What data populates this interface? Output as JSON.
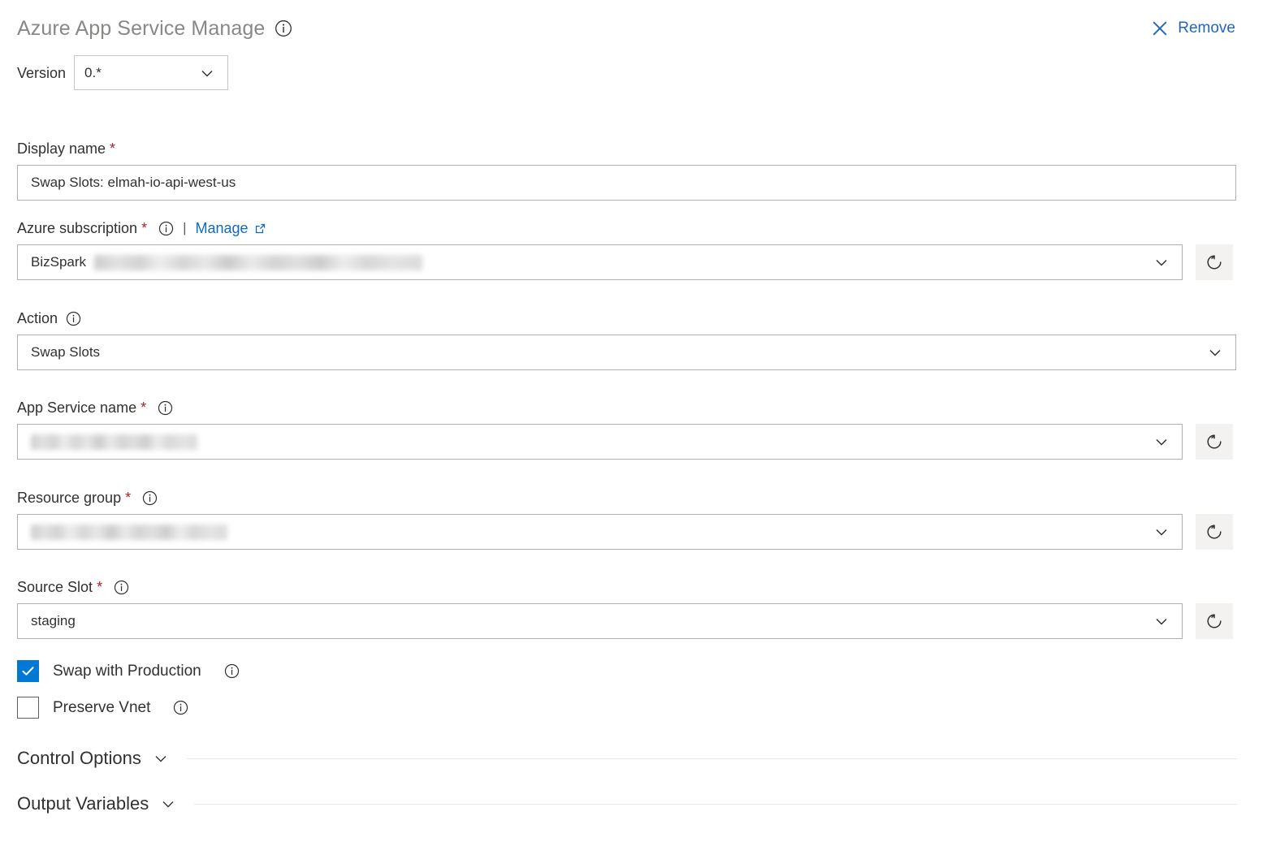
{
  "header": {
    "task_title": "Azure App Service Manage",
    "title_info_icon": "info-icon",
    "remove_label": "Remove",
    "remove_icon": "close-icon",
    "remove_color": "#2266bb"
  },
  "version": {
    "label": "Version",
    "value": "0.*",
    "chevron_icon": "chevron-down-icon"
  },
  "fields": {
    "display_name": {
      "label": "Display name",
      "required": true,
      "value": "Swap Slots: elmah-io-api-west-us"
    },
    "azure_subscription": {
      "label": "Azure subscription",
      "required": true,
      "info_icon": "info-icon",
      "separator": "|",
      "manage_label": "Manage",
      "manage_icon": "external-link-icon",
      "value": "BizSpark",
      "value_redacted": true,
      "refresh_icon": "refresh-icon"
    },
    "action": {
      "label": "Action",
      "required": false,
      "info_icon": "info-icon",
      "value": "Swap Slots",
      "chevron_icon": "chevron-down-icon"
    },
    "app_service_name": {
      "label": "App Service name",
      "required": true,
      "info_icon": "info-icon",
      "value": "",
      "value_redacted": true,
      "refresh_icon": "refresh-icon"
    },
    "resource_group": {
      "label": "Resource group",
      "required": true,
      "info_icon": "info-icon",
      "value": "",
      "value_redacted": true,
      "refresh_icon": "refresh-icon"
    },
    "source_slot": {
      "label": "Source Slot",
      "required": true,
      "info_icon": "info-icon",
      "value": "staging",
      "refresh_icon": "refresh-icon"
    }
  },
  "checkboxes": [
    {
      "label": "Swap with Production",
      "checked": true,
      "info_icon": "info-icon"
    },
    {
      "label": "Preserve Vnet",
      "checked": false,
      "info_icon": "info-icon"
    }
  ],
  "sections": [
    {
      "label": "Control Options",
      "chevron_icon": "chevron-down-icon",
      "expanded": false
    },
    {
      "label": "Output Variables",
      "chevron_icon": "chevron-down-icon",
      "expanded": false
    }
  ],
  "colors": {
    "accent": "#0078d4",
    "link": "#0f6cbd",
    "required": "#a4262c",
    "title": "#8a8886",
    "border": "#b3b0ad"
  }
}
